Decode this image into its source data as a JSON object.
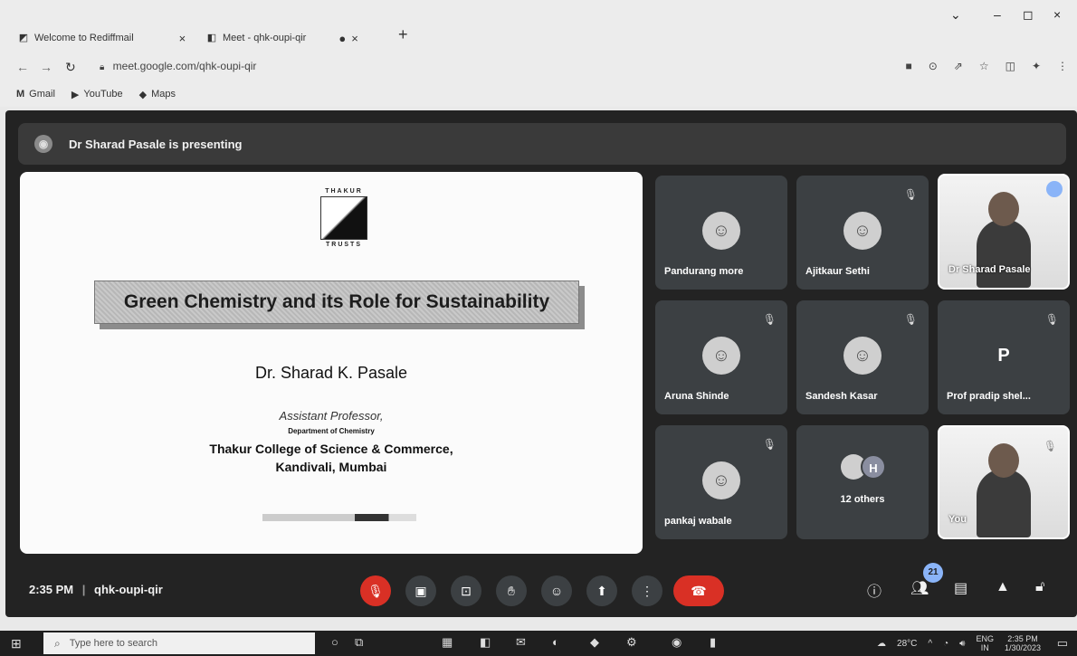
{
  "browser": {
    "tabs": [
      {
        "title": "Welcome to Rediffmail",
        "close": "×"
      },
      {
        "title": "Meet - qhk-oupi-qir",
        "close": "×"
      }
    ],
    "new_tab": "+",
    "window": {
      "minimize": "–",
      "maximize": "◻",
      "close": "×",
      "dropdown": "⌄"
    },
    "url": "meet.google.com/qhk-oupi-qir",
    "bookmarks": [
      {
        "label": "Gmail",
        "icon": "M"
      },
      {
        "label": "YouTube",
        "icon": "▶"
      },
      {
        "label": "Maps",
        "icon": "◆"
      }
    ]
  },
  "meet": {
    "presenting_text": "Dr Sharad Pasale is presenting",
    "slide": {
      "logo_top": "THAKUR",
      "logo_bottom": "TRUSTS",
      "title": "Green Chemistry and its Role for Sustainability",
      "author": "Dr. Sharad K. Pasale",
      "role": "Assistant Professor,",
      "department": "Department of Chemistry",
      "college": "Thakur College of Science & Commerce,",
      "city": "Kandivali, Mumbai"
    },
    "participants": [
      {
        "name": "Pandurang more",
        "muted": false
      },
      {
        "name": "Ajitkaur Sethi",
        "muted": true
      },
      {
        "name": "Dr Sharad Pasale",
        "muted": false
      },
      {
        "name": "Aruna Shinde",
        "muted": true
      },
      {
        "name": "Sandesh Kasar",
        "muted": true
      },
      {
        "name": "Prof pradip shel...",
        "muted": true,
        "initial": "P"
      },
      {
        "name": "pankaj wabale",
        "muted": true
      },
      {
        "name": "12 others",
        "initial": "H"
      },
      {
        "name": "You",
        "muted": true
      }
    ],
    "time": "2:35 PM",
    "separator": "|",
    "meeting_code": "qhk-oupi-qir",
    "participant_count": "21"
  },
  "taskbar": {
    "search_placeholder": "Type here to search",
    "temperature": "28°C",
    "language": "ENG",
    "region": "IN",
    "time": "2:35 PM",
    "date": "1/30/2023"
  }
}
